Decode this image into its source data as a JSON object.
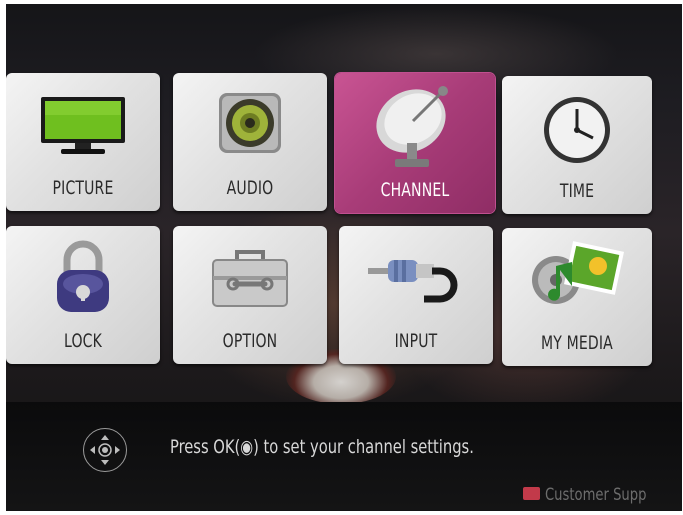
{
  "menu": {
    "items": [
      {
        "label": "PICTURE",
        "icon": "tv-icon"
      },
      {
        "label": "AUDIO",
        "icon": "speaker-icon"
      },
      {
        "label": "CHANNEL",
        "icon": "satellite-dish-icon",
        "selected": true
      },
      {
        "label": "TIME",
        "icon": "clock-icon"
      },
      {
        "label": "LOCK",
        "icon": "padlock-icon"
      },
      {
        "label": "OPTION",
        "icon": "toolbox-icon"
      },
      {
        "label": "INPUT",
        "icon": "cable-plug-icon"
      },
      {
        "label": "MY MEDIA",
        "icon": "media-icon"
      }
    ]
  },
  "footer": {
    "hint": "Press OK(◉) to set your channel settings.",
    "customer_support": "Customer Supp"
  },
  "colors": {
    "selected": "#b2427f",
    "tile": "#e4e4e4"
  }
}
